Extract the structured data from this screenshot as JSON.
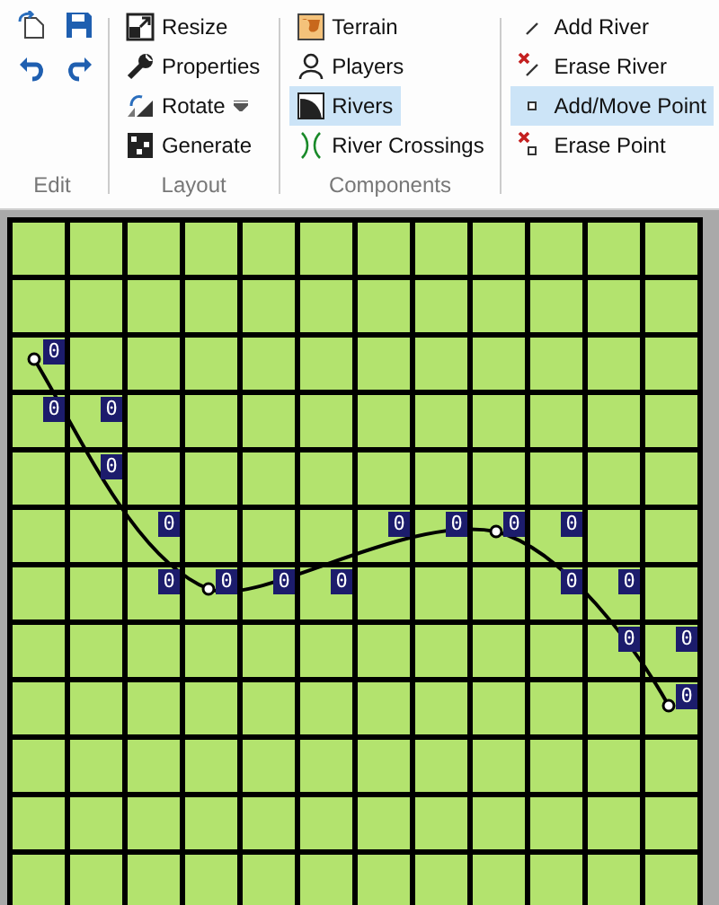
{
  "ribbon": {
    "groups": [
      {
        "label": "Edit",
        "tools": [
          {
            "kind": "import"
          },
          {
            "kind": "save"
          },
          {
            "kind": "undo"
          },
          {
            "kind": "redo"
          }
        ]
      },
      {
        "label": "Layout",
        "items": [
          {
            "kind": "resize",
            "label": "Resize",
            "selected": false
          },
          {
            "kind": "wrench",
            "label": "Properties",
            "selected": false
          },
          {
            "kind": "rotate",
            "label": "Rotate",
            "selected": false,
            "dropdown": true
          },
          {
            "kind": "generate",
            "label": "Generate",
            "selected": false
          }
        ]
      },
      {
        "label": "Components",
        "items": [
          {
            "kind": "terrain",
            "label": "Terrain",
            "selected": false
          },
          {
            "kind": "person",
            "label": "Players",
            "selected": false
          },
          {
            "kind": "curve",
            "label": "Rivers",
            "selected": true
          },
          {
            "kind": "crossing",
            "label": "River Crossings",
            "selected": false
          }
        ]
      },
      {
        "items": [
          {
            "kind": "line",
            "label": "Add River",
            "selected": false
          },
          {
            "kind": "erase-line",
            "label": "Erase River",
            "selected": false
          },
          {
            "kind": "point",
            "label": "Add/Move Point",
            "selected": true
          },
          {
            "kind": "erase-point",
            "label": "Erase Point",
            "selected": false
          }
        ]
      }
    ]
  },
  "map": {
    "rows": [
      {
        "cells": [
          {},
          {},
          {},
          {},
          {},
          {},
          {},
          {},
          {},
          {},
          {},
          {}
        ]
      },
      {
        "cells": [
          {},
          {},
          {},
          {},
          {},
          {},
          {},
          {},
          {},
          {},
          {},
          {}
        ]
      },
      {
        "cells": [
          {
            "value": "0"
          },
          {},
          {},
          {},
          {},
          {},
          {},
          {},
          {},
          {},
          {},
          {}
        ]
      },
      {
        "cells": [
          {
            "value": "0"
          },
          {
            "value": "0"
          },
          {},
          {},
          {},
          {},
          {},
          {},
          {},
          {},
          {},
          {}
        ]
      },
      {
        "cells": [
          {},
          {
            "value": "0"
          },
          {},
          {},
          {},
          {},
          {},
          {},
          {},
          {},
          {},
          {}
        ]
      },
      {
        "cells": [
          {},
          {},
          {
            "value": "0"
          },
          {},
          {},
          {},
          {
            "value": "0"
          },
          {
            "value": "0"
          },
          {
            "value": "0"
          },
          {
            "value": "0"
          },
          {},
          {}
        ]
      },
      {
        "cells": [
          {},
          {},
          {
            "value": "0"
          },
          {
            "value": "0"
          },
          {
            "value": "0"
          },
          {
            "value": "0"
          },
          {},
          {},
          {},
          {
            "value": "0"
          },
          {
            "value": "0"
          },
          {}
        ]
      },
      {
        "cells": [
          {},
          {},
          {},
          {},
          {},
          {},
          {},
          {},
          {},
          {},
          {
            "value": "0"
          },
          {
            "value": "0"
          }
        ]
      },
      {
        "cells": [
          {},
          {},
          {},
          {},
          {},
          {},
          {},
          {},
          {},
          {},
          {},
          {
            "value": "0"
          }
        ]
      },
      {
        "cells": [
          {},
          {},
          {},
          {},
          {},
          {},
          {},
          {},
          {},
          {},
          {},
          {}
        ]
      },
      {
        "cells": [
          {},
          {},
          {},
          {},
          {},
          {},
          {},
          {},
          {},
          {},
          {},
          {}
        ]
      },
      {
        "cells": [
          {},
          {},
          {},
          {},
          {},
          {},
          {},
          {},
          {},
          {},
          {},
          {}
        ]
      }
    ]
  }
}
